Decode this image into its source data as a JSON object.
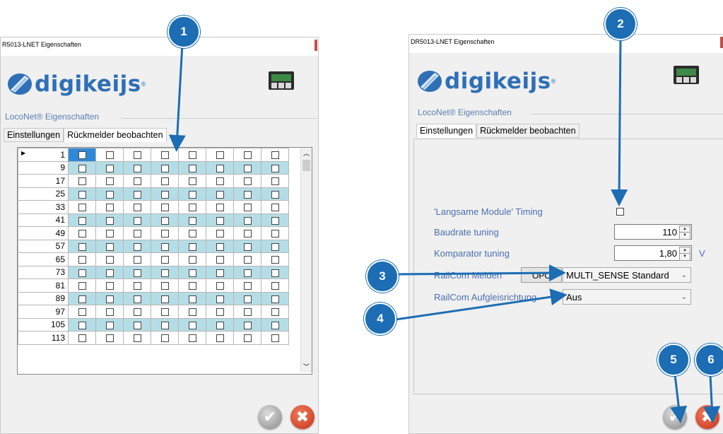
{
  "left_window": {
    "title": "R5013-LNET Eigenschaften",
    "logo_text": "digikeijs",
    "logo_reg": "®",
    "group_label": "LocoNet® Eigenschaften",
    "tabs": [
      "Einstellungen",
      "Rückmelder beobachten"
    ],
    "row_headers": [
      "1",
      "9",
      "17",
      "25",
      "33",
      "41",
      "49",
      "57",
      "65",
      "73",
      "81",
      "89",
      "97",
      "105",
      "113"
    ],
    "column_count": 8,
    "selected_cell": {
      "row": 0,
      "col": 0
    }
  },
  "right_window": {
    "title": "DR5013-LNET Eigenschaften",
    "logo_text": "digikeijs",
    "logo_reg": "®",
    "group_label": "LocoNet® Eigenschaften",
    "tabs": [
      "Einstellungen",
      "Rückmelder beobachten"
    ],
    "fields": {
      "langsame_label": "'Langsame Module' Timing",
      "langsame_checked": false,
      "baudrate_label": "Baudrate tuning",
      "baudrate_value": "110",
      "komparator_label": "Komparator tuning",
      "komparator_value": "1,80",
      "komparator_unit": "V",
      "railcom_melden_label": "RailCom Melden",
      "opc_button": "OPC",
      "railcom_melden_value": "MULTI_SENSE Standard",
      "railcom_aufgleis_label": "RailCom Aufgleisrichtung",
      "railcom_aufgleis_value": "Aus"
    }
  },
  "callouts": [
    "1",
    "2",
    "3",
    "4",
    "5",
    "6"
  ],
  "icons": {
    "ok": "checkmark-icon",
    "cancel": "close-icon",
    "device": "device-icon"
  },
  "colors": {
    "accent": "#1c6db4",
    "brand": "#2f6fb5",
    "grid_alt": "#b5dde6",
    "selected": "#2e8ad8"
  }
}
